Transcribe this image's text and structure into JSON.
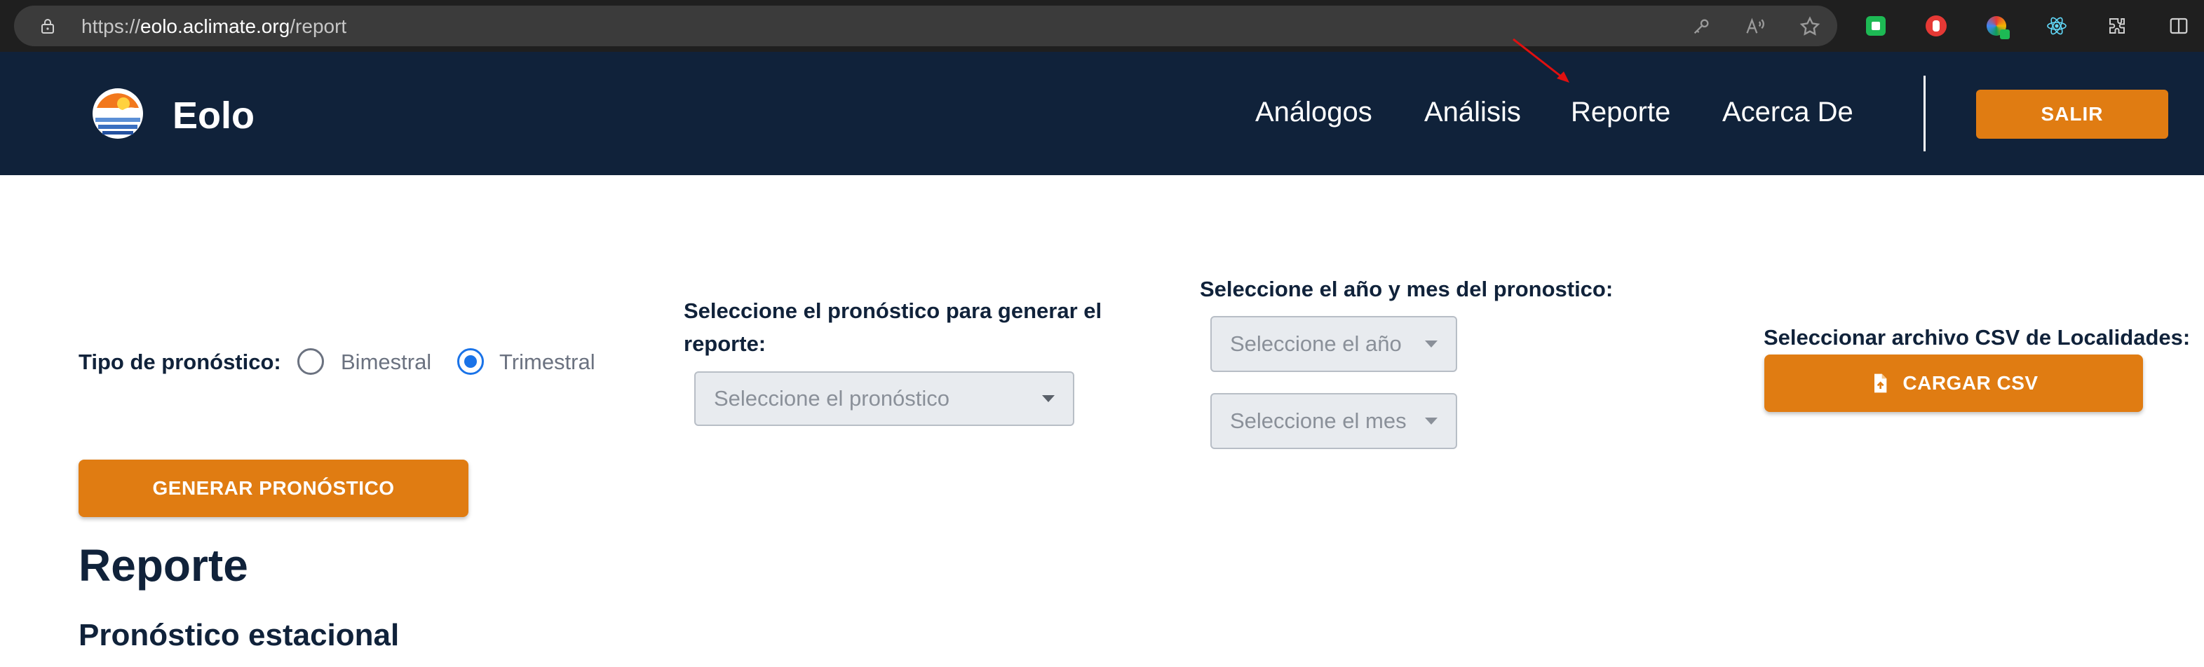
{
  "browser": {
    "url_prefix": "https://",
    "url_domain": "eolo.aclimate.org",
    "url_path": "/report"
  },
  "header": {
    "brand": "Eolo",
    "nav": [
      "Análogos",
      "Análisis",
      "Reporte",
      "Acerca De"
    ],
    "logout_label": "SALIR"
  },
  "form": {
    "forecast_type_label": "Tipo de pronóstico:",
    "options": [
      "Bimestral",
      "Trimestral"
    ],
    "selected_option": "Trimestral",
    "forecast_select_label_line1": "Seleccione el pronóstico para generar el",
    "forecast_select_label_line2": "reporte:",
    "forecast_select_placeholder": "Seleccione el pronóstico",
    "date_label": "Seleccione el año y mes del pronostico:",
    "year_placeholder": "Seleccione el año",
    "month_placeholder": "Seleccione el mes",
    "csv_label": "Seleccionar archivo CSV de Localidades:",
    "upload_button": "CARGAR CSV",
    "generate_button": "GENERAR PRONÓSTICO"
  },
  "content": {
    "title": "Reporte",
    "subtitle": "Pronóstico estacional"
  },
  "colors": {
    "navy": "#10223a",
    "orange": "#e07c12",
    "radio_selected": "#1a73e8"
  }
}
